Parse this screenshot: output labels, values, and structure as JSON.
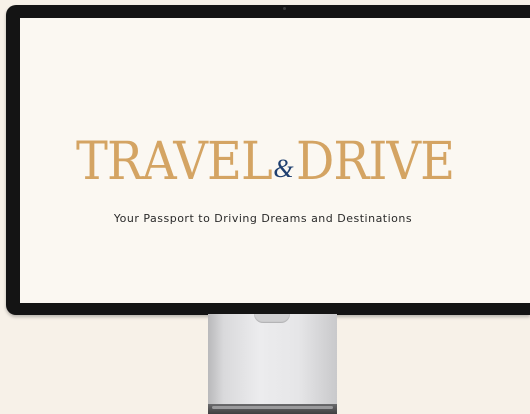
{
  "screen": {
    "title_left": "TRAVEL",
    "title_ampersand": "&",
    "title_right": "DRIVE",
    "tagline": "Your Passport to Driving Dreams and Destinations"
  },
  "colors": {
    "background": "#f7f1e8",
    "screen": "#fbf8f2",
    "title_gold": "#d4a463",
    "ampersand_navy": "#1e3f70",
    "tagline": "#2a2a2a",
    "bezel": "#141414"
  },
  "icons": {
    "camera": "camera-dot-icon"
  }
}
